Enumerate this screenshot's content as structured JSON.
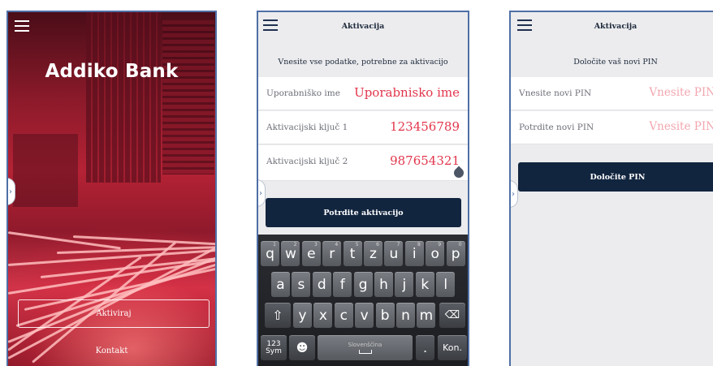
{
  "colors": {
    "brand_red": "#e2364c",
    "navy": "#12253f",
    "frame": "#4f6fa6",
    "screen_bg": "#ececee"
  },
  "icons": {
    "menu": "hamburger-icon",
    "side_tab": "chevron-right-icon",
    "backspace": "backspace-icon",
    "shift": "shift-icon",
    "emoji": "smiley-icon"
  },
  "splash": {
    "logo": "Addiko Bank",
    "activate_label": "Aktiviraj",
    "contact_label": "Kontakt"
  },
  "activation": {
    "title": "Aktivacija",
    "subtitle": "Vnesite vse podatke, potrebne za aktivacijo",
    "fields": [
      {
        "label": "Uporabniško ime",
        "value": "Uporabnisko ime"
      },
      {
        "label": "Aktivacijski ključ 1",
        "value": "123456789"
      },
      {
        "label": "Aktivacijski ključ 2",
        "value": "987654321"
      }
    ],
    "confirm_label": "Potrdite aktivacijo"
  },
  "keyboard": {
    "row1": [
      {
        "key": "q",
        "hint": "1"
      },
      {
        "key": "w",
        "hint": "2"
      },
      {
        "key": "e",
        "hint": "3"
      },
      {
        "key": "r",
        "hint": "4"
      },
      {
        "key": "t",
        "hint": "5"
      },
      {
        "key": "z",
        "hint": "6"
      },
      {
        "key": "u",
        "hint": "7"
      },
      {
        "key": "i",
        "hint": "8"
      },
      {
        "key": "o",
        "hint": "9"
      },
      {
        "key": "p",
        "hint": "0"
      }
    ],
    "row2": [
      "a",
      "s",
      "d",
      "f",
      "g",
      "h",
      "j",
      "k",
      "l"
    ],
    "row3": [
      "y",
      "x",
      "c",
      "v",
      "b",
      "n",
      "m"
    ],
    "symbols_label": "123\nSym",
    "language_label": "Slovenščina",
    "period_label": ".",
    "action_label": "Kon."
  },
  "pin": {
    "title": "Aktivacija",
    "subtitle": "Določite vaš novi PIN",
    "fields": [
      {
        "label": "Vnesite novi PIN",
        "placeholder": "Vnesite PIN"
      },
      {
        "label": "Potrdite novi PIN",
        "placeholder": "Vnesite PIN"
      }
    ],
    "set_pin_label": "Določite PIN"
  }
}
